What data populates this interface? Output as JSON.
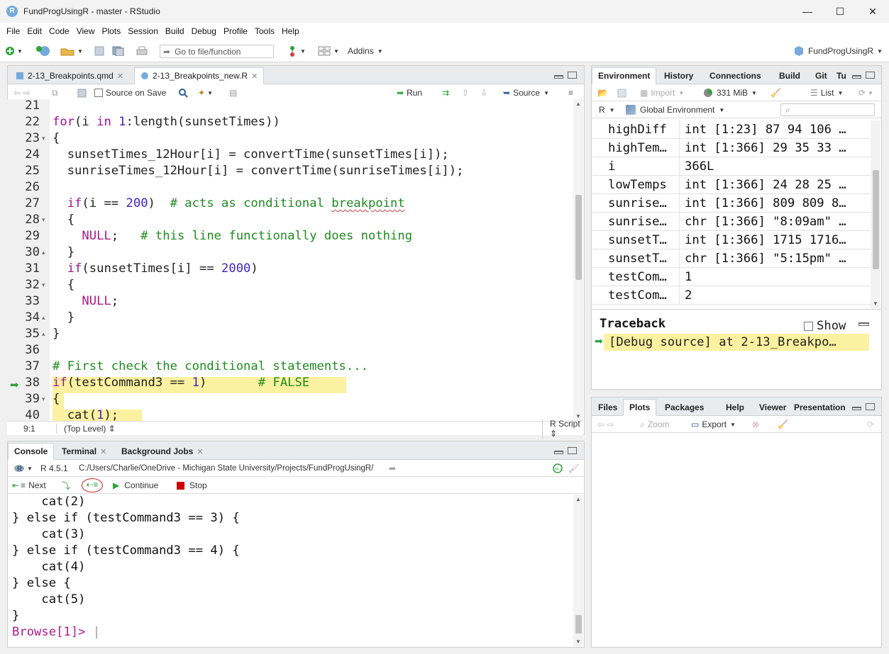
{
  "window": {
    "title": "FundProgUsingR - master - RStudio",
    "logo": "R",
    "minimize": "—",
    "maximize": "☐",
    "close": "✕"
  },
  "menu": [
    "File",
    "Edit",
    "Code",
    "View",
    "Plots",
    "Session",
    "Build",
    "Debug",
    "Profile",
    "Tools",
    "Help"
  ],
  "toolbar": {
    "goto_placeholder": "Go to file/function",
    "addins": "Addins",
    "project": "FundProgUsingR"
  },
  "editor": {
    "tabs": [
      {
        "label": "2-13_Breakpoints.qmd",
        "active": false
      },
      {
        "label": "2-13_Breakpoints_new.R",
        "active": true
      }
    ],
    "source_on_save": "Source on Save",
    "run": "Run",
    "source": "Source",
    "lines": [
      {
        "n": "21",
        "fold": ""
      },
      {
        "n": "22",
        "fold": ""
      },
      {
        "n": "23",
        "fold": "▾"
      },
      {
        "n": "24",
        "fold": ""
      },
      {
        "n": "25",
        "fold": ""
      },
      {
        "n": "26",
        "fold": ""
      },
      {
        "n": "27",
        "fold": ""
      },
      {
        "n": "28",
        "fold": "▾"
      },
      {
        "n": "29",
        "fold": ""
      },
      {
        "n": "30",
        "fold": "▴"
      },
      {
        "n": "31",
        "fold": ""
      },
      {
        "n": "32",
        "fold": "▾"
      },
      {
        "n": "33",
        "fold": ""
      },
      {
        "n": "34",
        "fold": "▴"
      },
      {
        "n": "35",
        "fold": "▴"
      },
      {
        "n": "36",
        "fold": ""
      },
      {
        "n": "37",
        "fold": ""
      },
      {
        "n": "38",
        "fold": ""
      },
      {
        "n": "39",
        "fold": "▾"
      },
      {
        "n": "40",
        "fold": ""
      }
    ],
    "code": {
      "l22a": "for",
      "l22b": "(i ",
      "l22c": "in",
      "l22d": " ",
      "l22e": "1",
      "l22f": ":length(sunsetTimes))",
      "l23": "{",
      "l24": "  sunsetTimes_12Hour[i] = convertTime(sunsetTimes[i]);",
      "l25": "  sunriseTimes_12Hour[i] = convertTime(sunriseTimes[i]);",
      "l27a": "  if",
      "l27b": "(i == ",
      "l27c": "200",
      "l27d": ")  ",
      "l27e": "# acts as conditional ",
      "l27f": "breakpoint",
      "l28": "  {",
      "l29a": "    NULL",
      "l29b": ";   ",
      "l29c": "# this line functionally does nothing",
      "l30": "  }",
      "l31a": "  if",
      "l31b": "(sunsetTimes[i] == ",
      "l31c": "2000",
      "l31d": ")",
      "l32": "  {",
      "l33a": "    NULL",
      "l33b": ";",
      "l34": "  }",
      "l35": "}",
      "l37": "# First check the conditional statements...",
      "l38a": "if",
      "l38b": "(testCommand3 == ",
      "l38c": "1",
      "l38d": ")       ",
      "l38e": "# FALSE",
      "l39": "{",
      "l40a": "  cat(",
      "l40b": "1",
      "l40c": ");"
    },
    "status_pos": "9:1",
    "status_scope": "(Top Level) ⇕",
    "status_type": "R Script ⇕"
  },
  "console": {
    "tabs": [
      "Console",
      "Terminal",
      "Background Jobs"
    ],
    "r_version": "R 4.5.1",
    "path": "C:/Users/Charlie/OneDrive - Michigan State University/Projects/FundProgUsingR/",
    "next": "Next",
    "continue": "Continue",
    "stop": "Stop",
    "lines": [
      "    cat(2)",
      "} else if (testCommand3 == 3) {",
      "    cat(3)",
      "} else if (testCommand3 == 4) {",
      "    cat(4)",
      "} else {",
      "    cat(5)",
      "}"
    ],
    "prompt": "Browse[1]> "
  },
  "environment": {
    "tabs": [
      "Environment",
      "History",
      "Connections",
      "Build",
      "Git",
      "Tu"
    ],
    "import": "Import",
    "memory": "331 MiB",
    "view_mode": "List",
    "language": "R",
    "scope": "Global Environment",
    "rows": [
      {
        "name": "highDiff",
        "value": "int [1:23] 87 94 106 …"
      },
      {
        "name": "highTem…",
        "value": "int [1:366] 29 35 33 …"
      },
      {
        "name": "i",
        "value": "366L"
      },
      {
        "name": "lowTemps",
        "value": "int [1:366] 24 28 25 …"
      },
      {
        "name": "sunrise…",
        "value": "int [1:366] 809 809 8…"
      },
      {
        "name": "sunrise…",
        "value": "chr [1:366] \"8:09am\" …"
      },
      {
        "name": "sunsetT…",
        "value": "int [1:366] 1715 1716…"
      },
      {
        "name": "sunsetT…",
        "value": "chr [1:366] \"5:15pm\" …"
      },
      {
        "name": "testCom…",
        "value": "1"
      },
      {
        "name": "testCom…",
        "value": "2"
      }
    ],
    "traceback_title": "Traceback",
    "traceback_show": "Show",
    "traceback_entry": "[Debug source] at 2-13_Breakpo…"
  },
  "files": {
    "tabs": [
      "Files",
      "Plots",
      "Packages",
      "Help",
      "Viewer",
      "Presentation"
    ],
    "zoom": "Zoom",
    "export": "Export"
  },
  "colors": {
    "accent": "#75aadb",
    "debug_highlight": "#fbf1a0",
    "keyword": "#a0109a",
    "comment": "#1f8a1f",
    "number": "#3e24c2",
    "prompt": "#b01a8a"
  }
}
